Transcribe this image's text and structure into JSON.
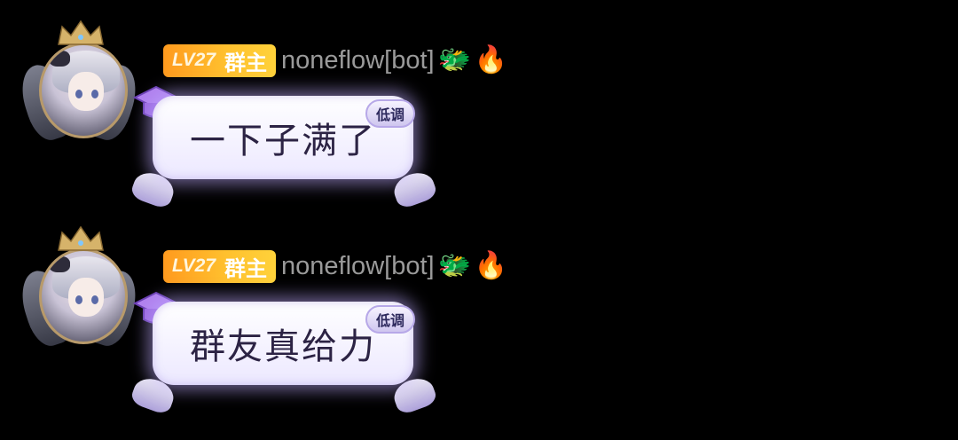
{
  "messages": [
    {
      "badge_level": "LV27",
      "badge_role": "群主",
      "username": "noneflow[bot]",
      "tag": "低调",
      "text": "一下子满了"
    },
    {
      "badge_level": "LV27",
      "badge_role": "群主",
      "username": "noneflow[bot]",
      "tag": "低调",
      "text": "群友真给力"
    }
  ],
  "colors": {
    "background": "#000000",
    "badge_gradient_start": "#ff9a1e",
    "badge_gradient_end": "#ffd23a",
    "username": "#9a9a9a",
    "bubble_glow": "#beaaff",
    "bubble_text": "#2c2344"
  },
  "icons": {
    "dragon": "dragon-icon",
    "fire": "fire-icon",
    "crown": "crown-icon",
    "mortarboard": "graduation-cap-icon"
  }
}
